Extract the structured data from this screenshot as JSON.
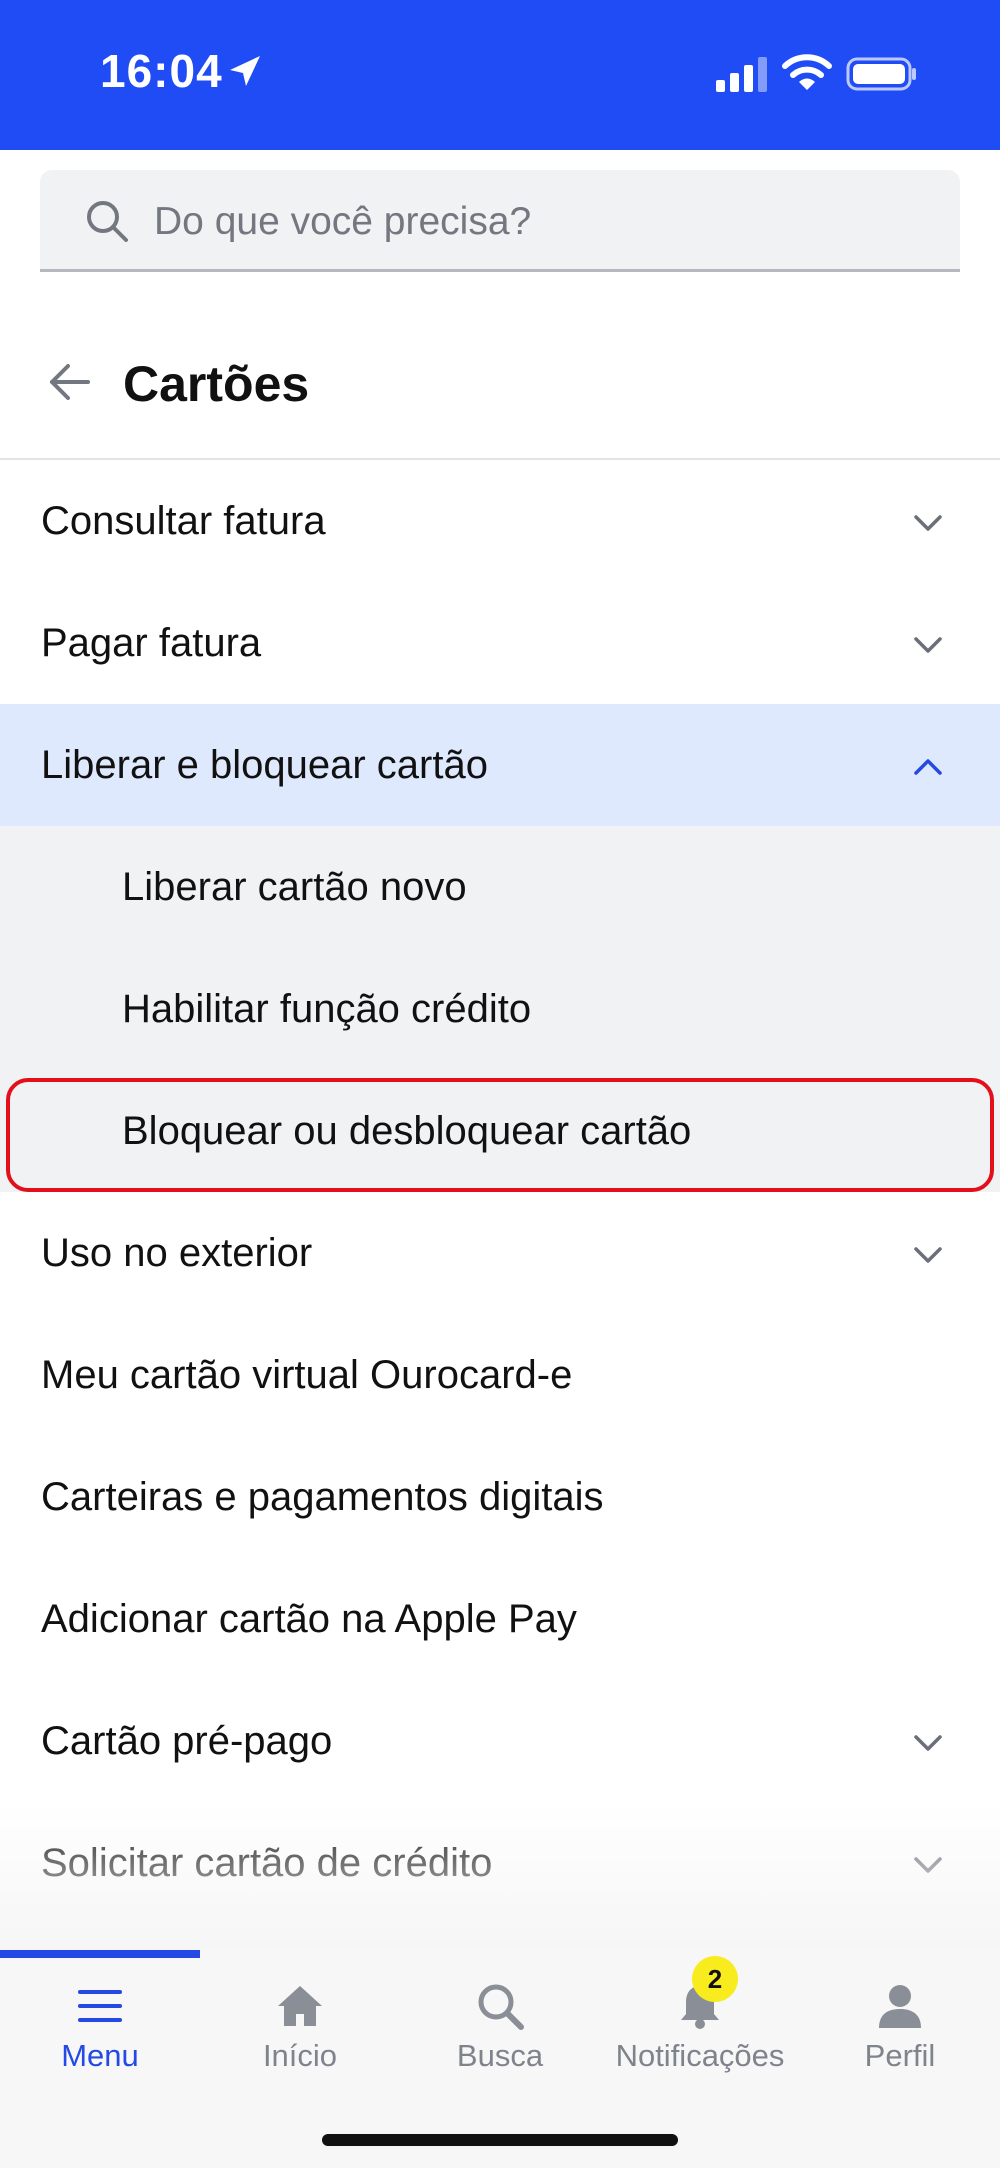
{
  "status_bar": {
    "time": "16:04",
    "background": "#1f4cf5"
  },
  "search": {
    "placeholder": "Do que você precisa?"
  },
  "header": {
    "title": "Cartões"
  },
  "menu": [
    {
      "label": "Consultar fatura",
      "chevron": "chevron-down-icon"
    },
    {
      "label": "Pagar fatura",
      "chevron": "chevron-down-icon"
    },
    {
      "label": "Liberar e bloquear cartão",
      "chevron": "chevron-up-icon",
      "expanded": true
    },
    {
      "label": "Liberar cartão novo",
      "sub": true
    },
    {
      "label": "Habilitar função crédito",
      "sub": true
    },
    {
      "label": "Bloquear ou desbloquear cartão",
      "sub": true,
      "highlighted": true
    },
    {
      "label": "Uso no exterior",
      "chevron": "chevron-down-icon"
    },
    {
      "label": "Meu cartão virtual Ourocard-e"
    },
    {
      "label": "Carteiras e pagamentos digitais"
    },
    {
      "label": "Adicionar cartão na Apple Pay"
    },
    {
      "label": "Cartão pré-pago",
      "chevron": "chevron-down-icon"
    },
    {
      "label": "Solicitar cartão de crédito",
      "chevron": "chevron-down-icon"
    }
  ],
  "tabs": [
    {
      "label": "Menu",
      "icon": "menu-icon",
      "active": true
    },
    {
      "label": "Início",
      "icon": "home-icon"
    },
    {
      "label": "Busca",
      "icon": "search-icon"
    },
    {
      "label": "Notificações",
      "icon": "bell-icon",
      "badge": "2"
    },
    {
      "label": "Perfil",
      "icon": "person-icon"
    }
  ],
  "colors": {
    "brand_blue": "#1f4cf5",
    "active_tab": "#2549e4",
    "expanded_row": "#dfe9fd",
    "submenu_bg": "#f1f2f4",
    "highlight_border": "#e3101c",
    "badge": "#f8ec1f"
  }
}
